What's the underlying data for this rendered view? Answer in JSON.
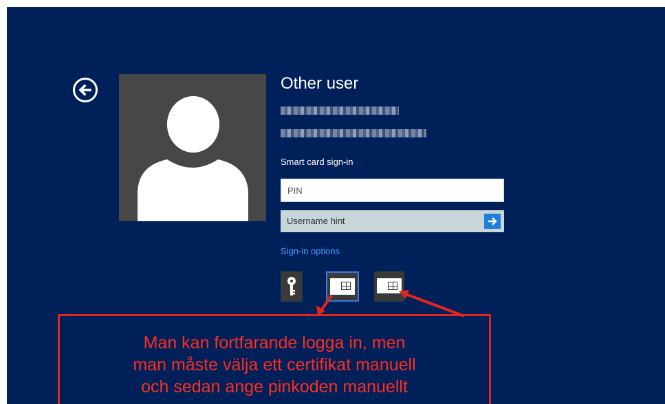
{
  "login": {
    "title": "Other user",
    "smartcard_label": "Smart card sign-in",
    "pin_placeholder": "PIN",
    "hint_text": "Username hint",
    "signin_options_label": "Sign-in options"
  },
  "icons": {
    "back": "back-arrow-circle-icon",
    "submit": "arrow-right-icon",
    "option_password": "key-icon",
    "option_smartcard": "smart-card-icon"
  },
  "annotation": {
    "lines": [
      "Man kan fortfarande logga in, men",
      "man måste välja ett certifikat manuell",
      "och sedan ange pinkoden manuellt"
    ]
  },
  "colors": {
    "background": "#00205a",
    "annotation_red": "#e3251c",
    "accent_blue": "#1e7fd9",
    "link_blue": "#4aa3ff",
    "avatar_bg": "#474747"
  }
}
